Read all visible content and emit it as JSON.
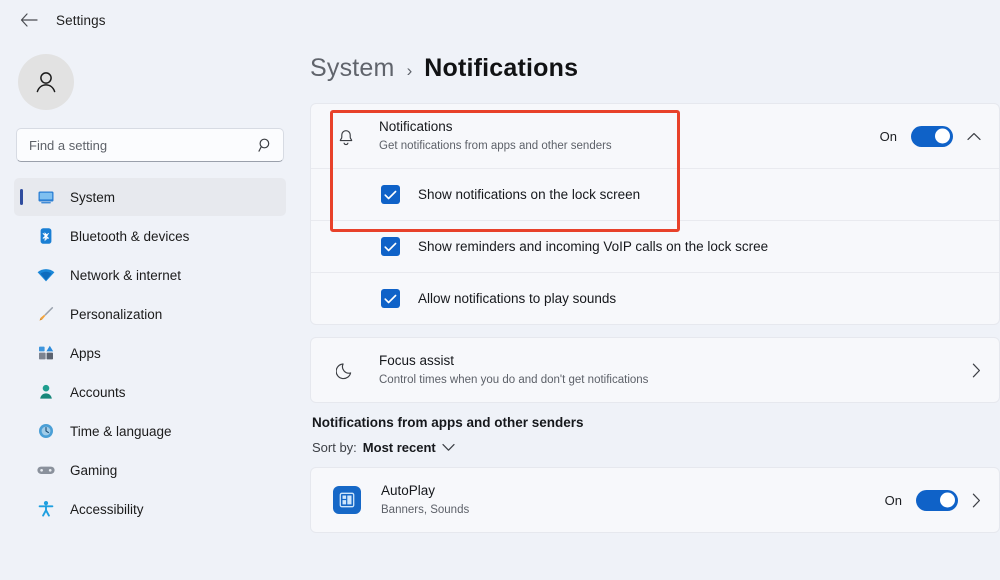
{
  "titlebar": {
    "back_icon": "arrow-left-icon",
    "title": "Settings"
  },
  "sidebar": {
    "avatar_icon": "person-icon",
    "search": {
      "placeholder": "Find a setting",
      "value": "",
      "icon": "search-icon"
    },
    "items": [
      {
        "label": "System",
        "icon": "monitor-icon",
        "active": true
      },
      {
        "label": "Bluetooth & devices",
        "icon": "bluetooth-icon",
        "active": false
      },
      {
        "label": "Network & internet",
        "icon": "wifi-icon",
        "active": false
      },
      {
        "label": "Personalization",
        "icon": "brush-icon",
        "active": false
      },
      {
        "label": "Apps",
        "icon": "apps-icon",
        "active": false
      },
      {
        "label": "Accounts",
        "icon": "account-icon",
        "active": false
      },
      {
        "label": "Time & language",
        "icon": "clock-globe-icon",
        "active": false
      },
      {
        "label": "Gaming",
        "icon": "gamepad-icon",
        "active": false
      },
      {
        "label": "Accessibility",
        "icon": "accessibility-icon",
        "active": false
      }
    ]
  },
  "main": {
    "breadcrumb": {
      "parent": "System",
      "separator": "›",
      "current": "Notifications"
    },
    "notifications_card": {
      "icon": "bell-icon",
      "title": "Notifications",
      "subtitle": "Get notifications from apps and other senders",
      "toggle_state_label": "On",
      "toggle_on": true,
      "expand_icon": "chevron-up-icon",
      "checkboxes": [
        {
          "label": "Show notifications on the lock screen",
          "checked": true
        },
        {
          "label": "Show reminders and incoming VoIP calls on the lock scree",
          "checked": true
        },
        {
          "label": "Allow notifications to play sounds",
          "checked": true
        }
      ]
    },
    "focus_assist_card": {
      "icon": "moon-icon",
      "title": "Focus assist",
      "subtitle": "Control times when you do and don't get notifications",
      "chevron_icon": "chevron-right-icon"
    },
    "apps_section": {
      "heading": "Notifications from apps and other senders",
      "sort_label": "Sort by:",
      "sort_value": "Most recent",
      "sort_chevron_icon": "chevron-down-icon",
      "apps": [
        {
          "icon": "autoplay-app-icon",
          "name": "AutoPlay",
          "subtitle": "Banners, Sounds",
          "toggle_state_label": "On",
          "toggle_on": true,
          "chevron_icon": "chevron-right-icon"
        }
      ]
    }
  },
  "annotation": {
    "highlight_color": "#e8412a",
    "target": "notifications-card-top"
  }
}
